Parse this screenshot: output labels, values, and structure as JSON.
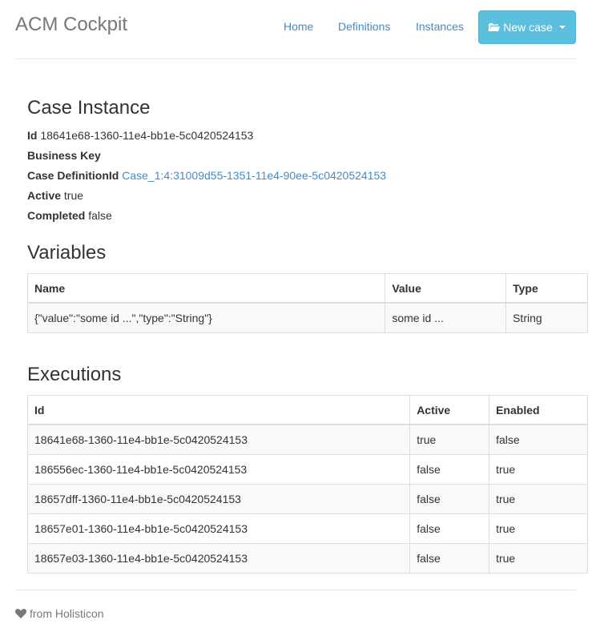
{
  "header": {
    "brand": "ACM Cockpit",
    "nav": [
      {
        "label": "Home"
      },
      {
        "label": "Definitions"
      },
      {
        "label": "Instances"
      }
    ],
    "new_case_label": "New case"
  },
  "case_instance": {
    "title": "Case Instance",
    "id_label": "Id",
    "id_value": "18641e68-1360-11e4-bb1e-5c0420524153",
    "business_key_label": "Business Key",
    "business_key_value": "",
    "definition_label": "Case DefinitionId",
    "definition_value": "Case_1:4:31009d55-1351-11e4-90ee-5c0420524153",
    "active_label": "Active",
    "active_value": "true",
    "completed_label": "Completed",
    "completed_value": "false"
  },
  "variables": {
    "title": "Variables",
    "columns": [
      "Name",
      "Value",
      "Type"
    ],
    "rows": [
      [
        "{\"value\":\"some id ...\",\"type\":\"String\"}",
        "some id ...",
        "String"
      ]
    ]
  },
  "executions": {
    "title": "Executions",
    "columns": [
      "Id",
      "Active",
      "Enabled"
    ],
    "rows": [
      [
        "18641e68-1360-11e4-bb1e-5c0420524153",
        "true",
        "false"
      ],
      [
        "186556ec-1360-11e4-bb1e-5c0420524153",
        "false",
        "true"
      ],
      [
        "18657dff-1360-11e4-bb1e-5c0420524153",
        "false",
        "true"
      ],
      [
        "18657e01-1360-11e4-bb1e-5c0420524153",
        "false",
        "true"
      ],
      [
        "18657e03-1360-11e4-bb1e-5c0420524153",
        "false",
        "true"
      ]
    ]
  },
  "footer": {
    "text": "from Holisticon",
    "icon": "heart-icon"
  }
}
